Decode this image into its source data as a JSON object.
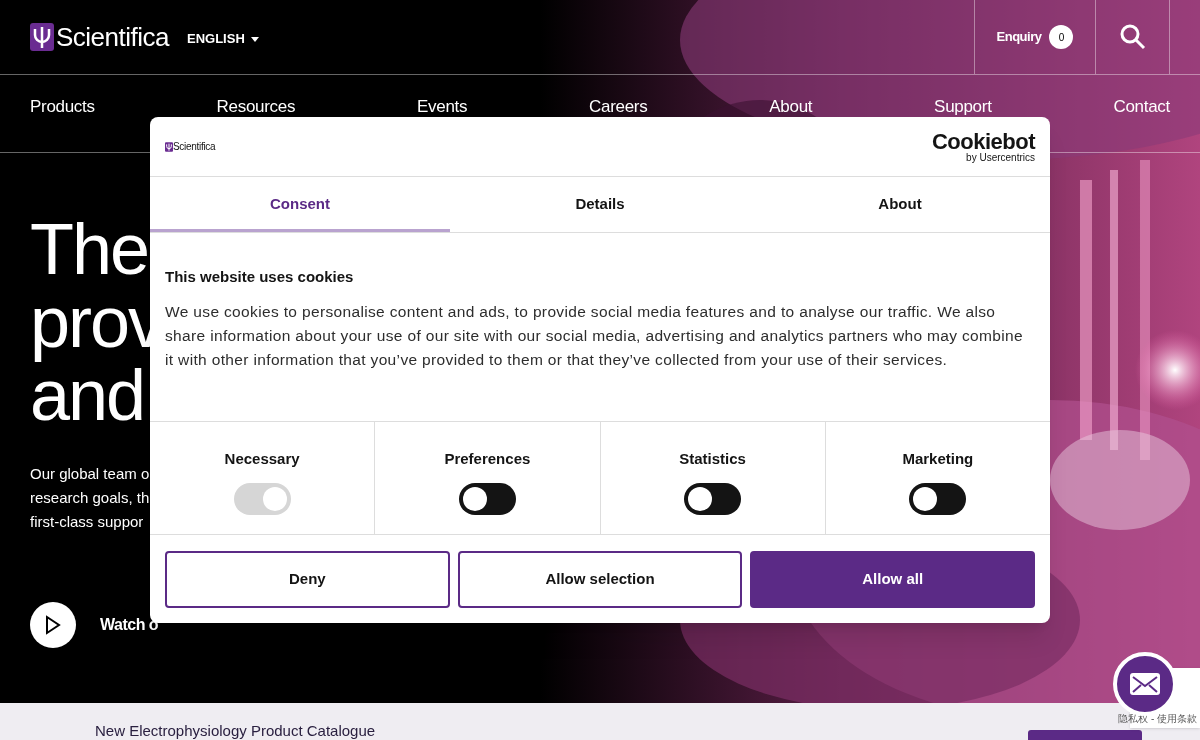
{
  "header": {
    "logo": "Scientifica",
    "language": "ENGLISH",
    "enquiry": {
      "label": "Enquiry",
      "count": "0"
    }
  },
  "nav": [
    "Products",
    "Resources",
    "Events",
    "Careers",
    "About",
    "Support",
    "Contact"
  ],
  "hero": {
    "headline": [
      "The",
      "prov",
      "and"
    ],
    "body": [
      "Our global team o",
      "research goals, th",
      "first-class suppor"
    ],
    "video_link": "Watch o"
  },
  "catalogue_banner": {
    "text": "New Electrophysiology Product Catalogue"
  },
  "recaptcha": {
    "links": "隐私权 - 使用条款"
  },
  "cookie_dialog": {
    "logo": "Scientifica",
    "brand": "Cookiebot",
    "brand_sub": "by Usercentrics",
    "tabs": [
      {
        "label": "Consent",
        "selected": true
      },
      {
        "label": "Details",
        "selected": false
      },
      {
        "label": "About",
        "selected": false
      }
    ],
    "title": "This website uses cookies",
    "body": "We use cookies to personalise content and ads, to provide social media features and to analyse our traffic. We also share information about your use of our site with our social media, advertising and analytics partners who may combine it with other information that you’ve provided to them or that they’ve collected from your use of their services.",
    "toggles": [
      {
        "label": "Necessary",
        "checked": true,
        "disabled": true
      },
      {
        "label": "Preferences",
        "checked": false,
        "disabled": false
      },
      {
        "label": "Statistics",
        "checked": false,
        "disabled": false
      },
      {
        "label": "Marketing",
        "checked": false,
        "disabled": false
      }
    ],
    "buttons": [
      {
        "label": "Deny",
        "kind": "outline"
      },
      {
        "label": "Allow selection",
        "kind": "outline"
      },
      {
        "label": "Allow all",
        "kind": "primary"
      }
    ]
  }
}
